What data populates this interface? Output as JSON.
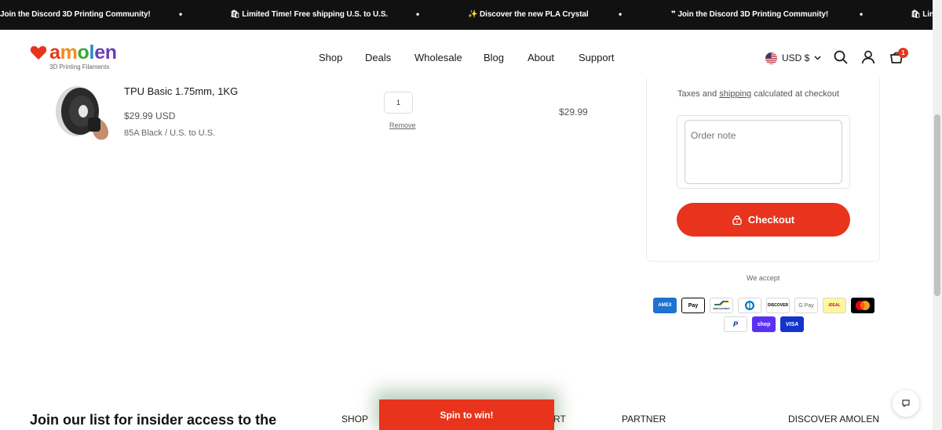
{
  "announcement": {
    "messages": [
      "Join the Discord 3D Printing Community!",
      "🛍 Limited Time! Free shipping U.S. to U.S.",
      "✨ Discover the new PLA Crystal",
      "❞ Join the Discord 3D Printing Community!",
      "🛍 Limi"
    ],
    "separator": "•"
  },
  "header": {
    "logo_text": "amolen",
    "logo_tagline": "3D Printing Filaments",
    "nav": [
      "Shop",
      "Deals",
      "Wholesale",
      "Blog",
      "About",
      "Support"
    ],
    "currency": "USD $",
    "cart_count": "1"
  },
  "cart_item": {
    "title": "TPU Basic 1.75mm, 1KG",
    "price": "$29.99 USD",
    "variant": "85A Black / U.S. to U.S.",
    "quantity": "1",
    "remove_label": "Remove",
    "line_total": "$29.99"
  },
  "summary": {
    "tax_prefix": "Taxes and ",
    "tax_link": "shipping",
    "tax_suffix": " calculated at checkout",
    "note_placeholder": "Order note",
    "checkout_label": "Checkout",
    "we_accept": "We accept"
  },
  "payments": [
    {
      "name": "amex-icon",
      "label": "AMEX"
    },
    {
      "name": "apple-pay-icon",
      "label": "Pay"
    },
    {
      "name": "bancontact-icon",
      "label": "bancontact"
    },
    {
      "name": "diners-club-icon",
      "label": ""
    },
    {
      "name": "discover-icon",
      "label": "DISCOVER"
    },
    {
      "name": "google-pay-icon",
      "label": "G Pay"
    },
    {
      "name": "ideal-icon",
      "label": "iDEAL"
    },
    {
      "name": "mastercard-icon",
      "label": ""
    },
    {
      "name": "paypal-icon",
      "label": "P"
    },
    {
      "name": "shop-pay-icon",
      "label": "shop"
    },
    {
      "name": "visa-icon",
      "label": "VISA"
    }
  ],
  "footer": {
    "join_text": "Join our list for insider access to the",
    "columns": [
      "SHOP",
      "RT",
      "PARTNER",
      "DISCOVER AMOLEN"
    ],
    "spin_label": "Spin to win!"
  },
  "colors": {
    "accent": "#e8341c",
    "announcement_bg": "#111111"
  }
}
